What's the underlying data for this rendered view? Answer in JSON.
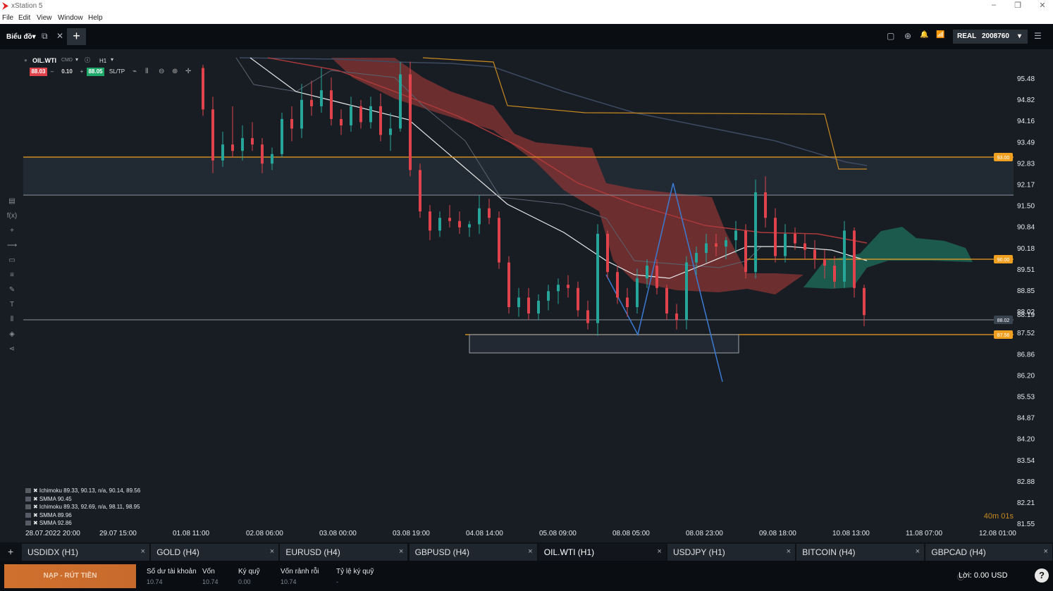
{
  "window": {
    "title": "xStation 5",
    "minimize": "–",
    "maximize": "❐",
    "close": "✕"
  },
  "menu": [
    "File",
    "Edit",
    "View",
    "Window",
    "Help"
  ],
  "topbar": {
    "chart_menu": "Biểu đồ▾",
    "popout_icon": "⧉",
    "close_icon": "✕",
    "add_icon": "+",
    "account_mode": "REAL",
    "account_number": "2008760",
    "account_caret": "▾",
    "right_icons": [
      "▢",
      "⊕",
      "🔔",
      "📶",
      "☰"
    ]
  },
  "symbol": {
    "name": "OIL.WTI",
    "type": "CMD",
    "timeframe": "H1",
    "sell": "88.03",
    "volume": "0.10",
    "buy": "88.05",
    "sltp": "SL/TP",
    "minus": "–",
    "plus": "+"
  },
  "left_tools": [
    "▤",
    "f(x)",
    "+",
    "⟶",
    "▭",
    "≡",
    "✎",
    "T",
    "⫴",
    "◈",
    "⋖"
  ],
  "price_axis": [
    "95.48",
    "94.82",
    "94.16",
    "93.49",
    "92.83",
    "92.17",
    "91.50",
    "90.84",
    "90.18",
    "89.51",
    "88.85",
    "88.19",
    "88.02",
    "87.52",
    "86.86",
    "86.20",
    "85.53",
    "84.87",
    "84.20",
    "83.54",
    "82.88",
    "82.21",
    "81.55"
  ],
  "price_markers": [
    {
      "label": "93.00",
      "color": "#f0a020"
    },
    {
      "label": "90.00",
      "color": "#f0a020"
    },
    {
      "label": "87.56",
      "color": "#f0a020"
    },
    {
      "label": "88.02",
      "color": "#3a4350"
    }
  ],
  "time_axis": [
    "28.07.2022 20:00",
    "29.07 15:00",
    "01.08 11:00",
    "02.08 06:00",
    "03.08 00:00",
    "03.08 19:00",
    "04.08 14:00",
    "05.08 09:00",
    "08.08 05:00",
    "08.08 23:00",
    "09.08 18:00",
    "10.08 13:00",
    "11.08 07:00",
    "12.08 01:00"
  ],
  "countdown": "40m 01s",
  "indicators": [
    "✖ Ichimoku 89.33, 90.13, n/a, 90.14, 89.56",
    "✖ SMMA 90.45",
    "✖ Ichimoku 89.33, 92.69, n/a, 98.11, 98.95",
    "✖ SMMA 89.96",
    "✖ SMMA 92.86"
  ],
  "tabs": [
    {
      "label": "USDIDX (H1)",
      "active": false
    },
    {
      "label": "GOLD (H4)",
      "active": false
    },
    {
      "label": "EURUSD (H4)",
      "active": false
    },
    {
      "label": "GBPUSD (H4)",
      "active": false
    },
    {
      "label": "OIL.WTI (H1)",
      "active": true
    },
    {
      "label": "USDJPY (H1)",
      "active": false
    },
    {
      "label": "BITCOIN (H4)",
      "active": false
    },
    {
      "label": "GBPCAD (H4)",
      "active": false
    }
  ],
  "tab_add": "+",
  "tab_close": "×",
  "footer": {
    "deposit": "NẠP - RÚT TIỀN",
    "stats": [
      {
        "label": "Số dư tài khoản",
        "value": "10.74"
      },
      {
        "label": "Vốn",
        "value": "10.74"
      },
      {
        "label": "Ký quỹ",
        "value": "0.00"
      },
      {
        "label": "Vốn rảnh rỗi",
        "value": "10.74"
      },
      {
        "label": "Tỷ lệ ký quỹ",
        "value": "-"
      }
    ],
    "profit": "Lời: 0.00 USD",
    "help": "?"
  },
  "colors": {
    "up": "#26a69a",
    "down": "#e0434b",
    "cloud_red": "#8a3434",
    "cloud_green": "#1e6a58",
    "orange": "#f0a020",
    "blue": "#3b7bd4"
  },
  "chart_data": {
    "type": "candlestick",
    "symbol": "OIL.WTI",
    "timeframe": "H1",
    "ylim": [
      81.55,
      96.0
    ],
    "horizontal_lines": [
      93.0,
      91.85,
      90.0,
      88.02,
      87.52
    ],
    "candles": [
      [
        95.8,
        95.9,
        94.3,
        94.5
      ],
      [
        94.5,
        94.9,
        92.5,
        92.9
      ],
      [
        92.9,
        93.8,
        92.7,
        93.4
      ],
      [
        93.4,
        94.6,
        93.0,
        93.2
      ],
      [
        93.2,
        94.0,
        92.9,
        93.6
      ],
      [
        93.6,
        94.1,
        93.2,
        93.4
      ],
      [
        93.4,
        93.6,
        92.5,
        92.8
      ],
      [
        92.8,
        93.3,
        92.6,
        93.1
      ],
      [
        93.1,
        94.4,
        93.0,
        94.2
      ],
      [
        94.2,
        94.6,
        93.5,
        93.9
      ],
      [
        93.9,
        95.3,
        93.6,
        94.8
      ],
      [
        94.8,
        95.4,
        94.3,
        94.6
      ],
      [
        94.6,
        95.8,
        94.4,
        95.1
      ],
      [
        95.1,
        95.5,
        94.0,
        94.2
      ],
      [
        94.2,
        94.5,
        93.7,
        94.0
      ],
      [
        94.0,
        94.9,
        93.8,
        94.6
      ],
      [
        94.6,
        94.8,
        93.9,
        94.1
      ],
      [
        94.1,
        94.9,
        93.9,
        94.6
      ],
      [
        94.6,
        95.0,
        93.5,
        93.7
      ],
      [
        93.7,
        94.4,
        93.2,
        93.9
      ],
      [
        93.9,
        96.0,
        93.8,
        95.6
      ],
      [
        95.6,
        96.0,
        92.4,
        92.6
      ],
      [
        92.6,
        92.8,
        91.1,
        91.3
      ],
      [
        91.3,
        91.5,
        90.4,
        90.7
      ],
      [
        90.7,
        91.3,
        90.5,
        91.1
      ],
      [
        91.1,
        91.5,
        90.8,
        91.0
      ],
      [
        91.0,
        91.3,
        90.6,
        90.8
      ],
      [
        90.8,
        91.0,
        90.5,
        90.9
      ],
      [
        90.9,
        91.8,
        90.6,
        91.4
      ],
      [
        91.4,
        91.7,
        90.9,
        91.1
      ],
      [
        91.1,
        91.3,
        89.5,
        89.7
      ],
      [
        89.7,
        89.9,
        88.1,
        88.3
      ],
      [
        88.3,
        88.9,
        88.0,
        88.6
      ],
      [
        88.6,
        88.9,
        87.9,
        88.1
      ],
      [
        88.1,
        88.7,
        87.9,
        88.5
      ],
      [
        88.5,
        89.0,
        88.2,
        88.8
      ],
      [
        88.8,
        89.2,
        88.4,
        89.0
      ],
      [
        89.0,
        89.3,
        88.6,
        88.9
      ],
      [
        88.9,
        89.1,
        88.0,
        88.2
      ],
      [
        88.2,
        88.5,
        87.6,
        87.8
      ],
      [
        87.8,
        90.9,
        87.4,
        90.6
      ],
      [
        90.6,
        90.7,
        89.2,
        89.4
      ],
      [
        89.4,
        89.6,
        88.4,
        88.6
      ],
      [
        88.6,
        88.9,
        88.0,
        88.3
      ],
      [
        88.3,
        89.5,
        88.1,
        89.2
      ],
      [
        89.2,
        89.8,
        88.9,
        89.6
      ],
      [
        89.6,
        89.8,
        88.7,
        88.9
      ],
      [
        88.9,
        89.0,
        87.9,
        88.1
      ],
      [
        88.1,
        88.4,
        87.6,
        87.9
      ],
      [
        87.9,
        89.9,
        87.6,
        89.7
      ],
      [
        89.7,
        90.2,
        89.3,
        90.0
      ],
      [
        90.0,
        90.6,
        89.7,
        90.3
      ],
      [
        90.3,
        90.6,
        89.9,
        90.2
      ],
      [
        90.2,
        90.5,
        89.8,
        90.4
      ],
      [
        90.4,
        91.0,
        90.0,
        90.7
      ],
      [
        90.7,
        90.9,
        89.2,
        89.4
      ],
      [
        89.4,
        92.3,
        89.2,
        91.9
      ],
      [
        91.9,
        92.4,
        90.8,
        91.1
      ],
      [
        91.1,
        91.4,
        89.7,
        89.9
      ],
      [
        89.9,
        90.9,
        89.7,
        90.6
      ],
      [
        90.6,
        90.8,
        90.1,
        90.3
      ],
      [
        90.3,
        90.6,
        89.8,
        90.1
      ],
      [
        90.1,
        90.4,
        89.5,
        89.8
      ],
      [
        89.8,
        90.1,
        89.2,
        89.6
      ],
      [
        89.6,
        89.9,
        88.9,
        89.1
      ],
      [
        89.1,
        91.0,
        88.9,
        90.7
      ],
      [
        90.7,
        90.8,
        88.6,
        88.9
      ],
      [
        88.9,
        89.0,
        87.7,
        88.05
      ]
    ]
  }
}
